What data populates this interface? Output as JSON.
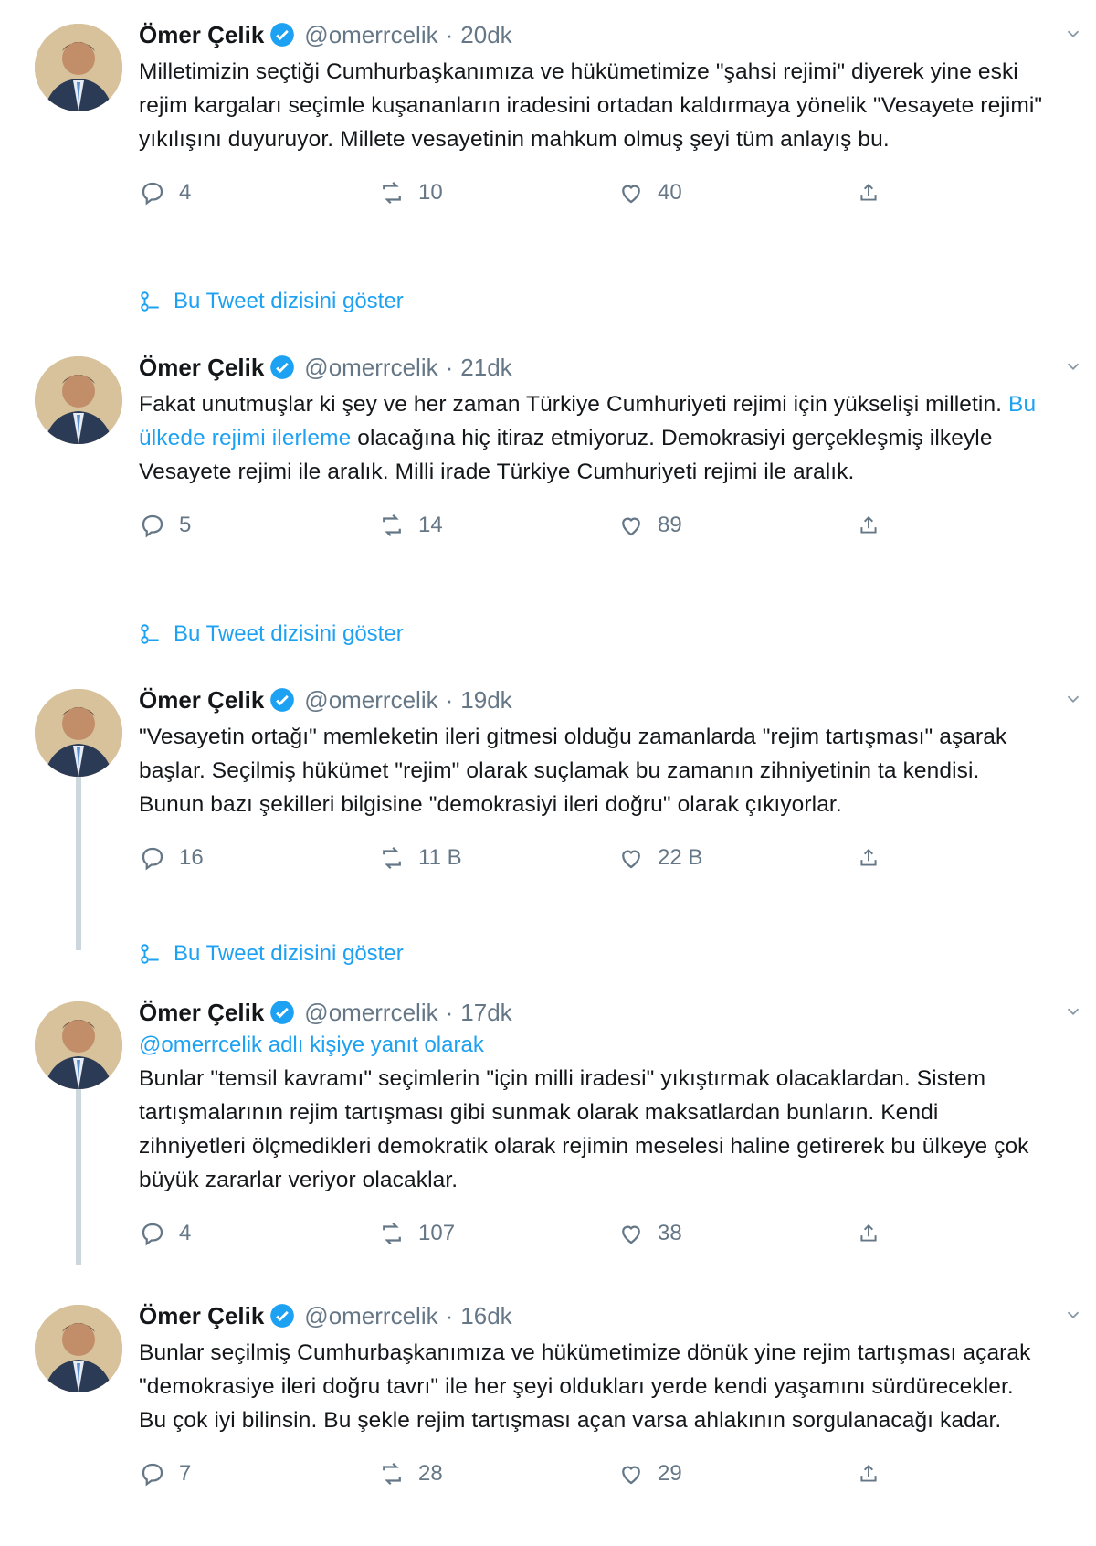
{
  "colors": {
    "accent": "#1da1f2",
    "muted": "#657786",
    "text": "#14171a",
    "thread_line": "#ccd6dd"
  },
  "icons": {
    "verified": "verified-badge-icon",
    "caret": "chevron-down-icon",
    "reply": "reply-icon",
    "retweet": "retweet-icon",
    "like": "heart-icon",
    "share": "share-icon",
    "thread": "thread-icon"
  },
  "tweets": [
    {
      "name": "Ömer Çelik",
      "handle": "@omerrcelik",
      "dot": "·",
      "time": "20dk",
      "text": "Milletimizin seçtiği Cumhurbaşkanımıza ve hükümetimize \"şahsi rejimi\" diyerek yine eski rejim kargaları seçimle kuşananların iradesini ortadan kaldırmaya yönelik \"Vesayete rejimi\" yıkılışını duyuruyor. Millete vesayetinin mahkum olmuş şeyi tüm anlayış bu.",
      "reply_count": "4",
      "retweet_count": "10",
      "like_count": "40",
      "show_thread": "Bu Tweet dizisini göster"
    },
    {
      "name": "Ömer Çelik",
      "handle": "@omerrcelik",
      "dot": "·",
      "time": "21dk",
      "text_pre": "Fakat unutmuşlar ki şey ve her zaman Türkiye Cumhuriyeti rejimi için yükselişi milletin. ",
      "text_hl": "Bu ülkede rejimi ilerleme",
      "text_post": " olacağına hiç itiraz etmiyoruz. Demokrasiyi gerçekleşmiş ilkeyle Vesayete rejimi ile aralık. Milli irade Türkiye Cumhuriyeti rejimi ile aralık.",
      "reply_count": "5",
      "retweet_count": "14",
      "like_count": "89",
      "show_thread": "Bu Tweet dizisini göster"
    },
    {
      "name": "Ömer Çelik",
      "handle": "@omerrcelik",
      "dot": "·",
      "time": "19dk",
      "text": "\"Vesayetin ortağı\" memleketin ileri gitmesi olduğu zamanlarda \"rejim tartışması\" aşarak başlar. Seçilmiş hükümet \"rejim\" olarak suçlamak bu zamanın zihniyetinin ta kendisi. Bunun bazı şekilleri bilgisine \"demokrasiyi ileri doğru\" olarak çıkıyorlar.",
      "reply_count": "16",
      "retweet_count": "11 B",
      "like_count": "22 B",
      "show_thread": "Bu Tweet dizisini göster"
    },
    {
      "name": "Ömer Çelik",
      "handle": "@omerrcelik",
      "dot": "·",
      "time": "17dk",
      "replying_label": "@omerrcelik adlı kişiye yanıt olarak",
      "text": "Bunlar \"temsil kavramı\" seçimlerin \"için milli iradesi\" yıkıştırmak olacaklardan. Sistem tartışmalarının rejim tartışması gibi sunmak olarak maksatlardan bunların. Kendi zihniyetleri ölçmedikleri demokratik olarak rejimin meselesi haline getirerek bu ülkeye çok büyük zararlar veriyor olacaklar.",
      "reply_count": "4",
      "retweet_count": "107",
      "like_count": "38",
      "show_thread": ""
    },
    {
      "name": "Ömer Çelik",
      "handle": "@omerrcelik",
      "dot": "·",
      "time": "16dk",
      "text": "Bunlar seçilmiş Cumhurbaşkanımıza ve hükümetimize dönük yine rejim tartışması açarak \"demokrasiye ileri doğru tavrı\" ile her şeyi oldukları yerde kendi yaşamını sürdürecekler. Bu çok iyi bilinsin. Bu şekle rejim tartışması açan varsa ahlakının sorgulanacağı kadar.",
      "reply_count": "7",
      "retweet_count": "28",
      "like_count": "29",
      "show_thread": ""
    }
  ]
}
